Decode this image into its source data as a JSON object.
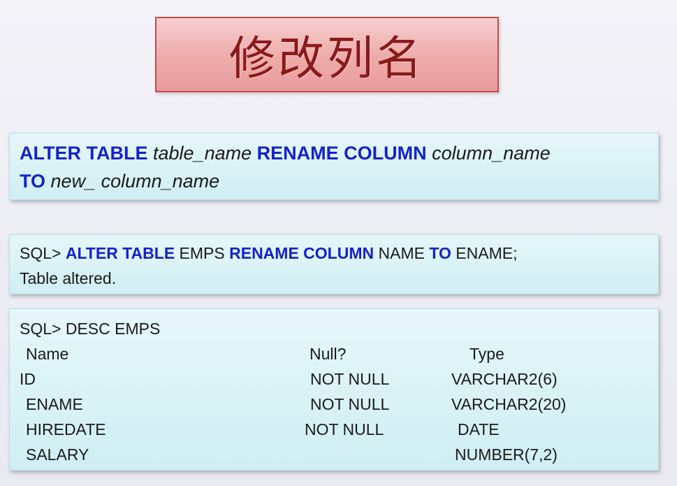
{
  "title": "修改列名",
  "syntax": {
    "kw_alter_table": "ALTER TABLE",
    "table_name": "table_name",
    "kw_rename_column": "RENAME COLUMN",
    "column_name": "column_name",
    "kw_to": "TO",
    "new_column_name": "new_ column_name"
  },
  "example": {
    "prompt": "SQL>",
    "kw_alter_table": "ALTER TABLE",
    "table": "EMPS",
    "kw_rename_column": "RENAME COLUMN",
    "old_name": "NAME",
    "kw_to": "TO",
    "new_name": "ENAME;",
    "result": "Table altered."
  },
  "desc": {
    "command": "SQL> DESC EMPS",
    "headers": {
      "name": "Name",
      "null": "Null?",
      "type": "Type"
    },
    "rows": [
      {
        "name": "ID",
        "null": "NOT NULL",
        "type": "VARCHAR2(6)"
      },
      {
        "name": "ENAME",
        "null": "NOT NULL",
        "type": "VARCHAR2(20)"
      },
      {
        "name": "HIREDATE",
        "null": "NOT NULL",
        "type": "DATE"
      },
      {
        "name": "SALARY",
        "null": "",
        "type": "NUMBER(7,2)"
      }
    ]
  }
}
